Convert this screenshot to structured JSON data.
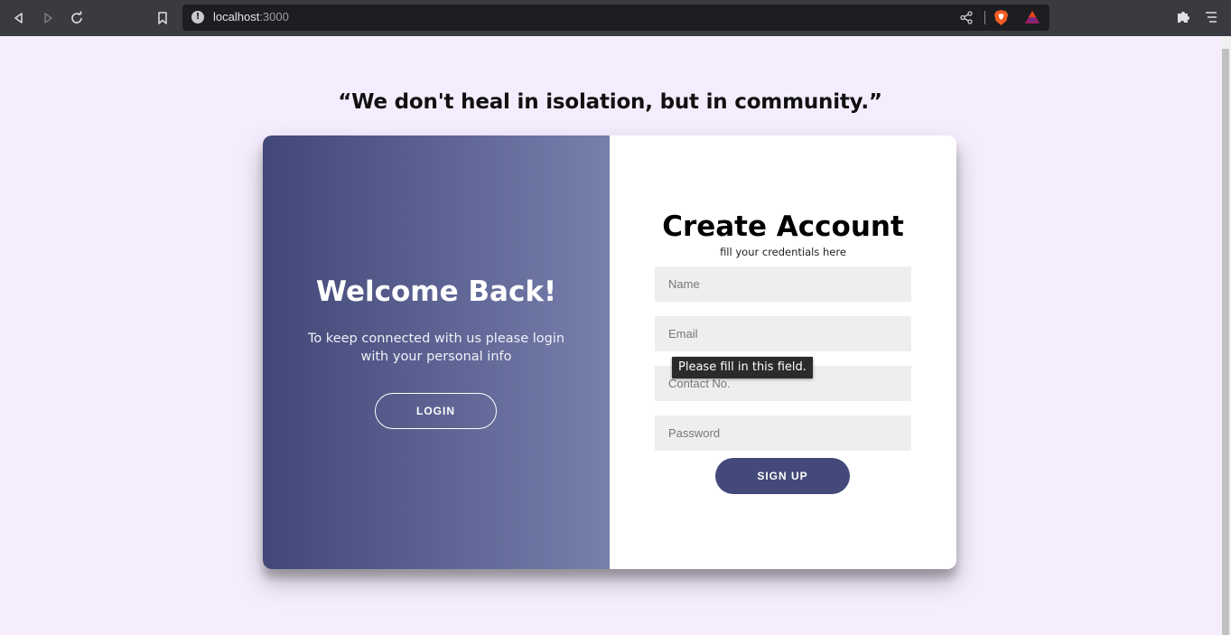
{
  "browser": {
    "url_host": "localhost",
    "url_port": ":3000",
    "icons": [
      "back-icon",
      "forward-icon",
      "reload-icon",
      "bookmark-icon",
      "site-info-icon",
      "share-icon",
      "brave-shields-icon",
      "brave-rewards-icon",
      "extensions-icon",
      "menu-icon"
    ]
  },
  "page": {
    "quote": "“We don't heal in isolation, but in community.”"
  },
  "left_panel": {
    "title": "Welcome Back!",
    "subtitle": "To keep connected with us please login with your personal info",
    "login_label": "LOGIN"
  },
  "right_panel": {
    "title": "Create Account",
    "subtitle": "fill your credentials here",
    "fields": {
      "name_placeholder": "Name",
      "email_placeholder": "Email",
      "contact_placeholder": "Contact No.",
      "password_placeholder": "Password"
    },
    "signup_label": "SIGN UP"
  },
  "validation_tooltip": "Please fill in this field.",
  "colors": {
    "page_bg": "#f5edfd",
    "gradient_start": "#414777",
    "gradient_end": "#777fad",
    "button_bg": "#434978"
  }
}
